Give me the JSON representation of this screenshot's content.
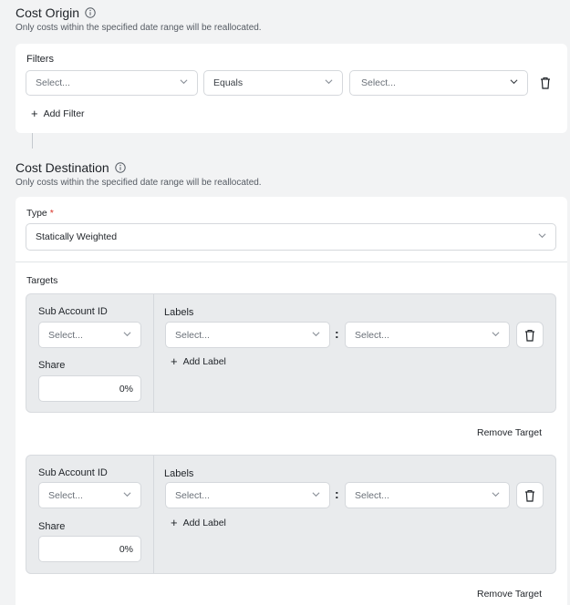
{
  "cost_origin": {
    "title": "Cost Origin",
    "subtitle": "Only costs within the specified date range will be reallocated.",
    "filters_label": "Filters",
    "filter_row": {
      "field_placeholder": "Select...",
      "operator_value": "Equals",
      "value_placeholder": "Select..."
    },
    "add_filter_label": "Add Filter"
  },
  "cost_destination": {
    "title": "Cost Destination",
    "subtitle": "Only costs within the specified date range will be reallocated.",
    "type_label": "Type",
    "type_required_mark": "*",
    "type_value": "Statically Weighted",
    "targets_label": "Targets",
    "targets": [
      {
        "sub_account_label": "Sub Account ID",
        "sub_account_placeholder": "Select...",
        "share_label": "Share",
        "share_value": "0%",
        "labels_label": "Labels",
        "label_key_placeholder": "Select...",
        "label_value_placeholder": "Select...",
        "add_label": "Add Label",
        "remove_label": "Remove Target"
      },
      {
        "sub_account_label": "Sub Account ID",
        "sub_account_placeholder": "Select...",
        "share_label": "Share",
        "share_value": "0%",
        "labels_label": "Labels",
        "label_key_placeholder": "Select...",
        "label_value_placeholder": "Select...",
        "add_label": "Add Label",
        "remove_label": "Remove Target"
      }
    ]
  },
  "icons": {
    "info": "info-icon",
    "chevron": "chevron-down-icon",
    "trash": "trash-icon",
    "plus": "plus-icon"
  },
  "colors": {
    "page_background": "#f2f3f4",
    "card_background": "#ffffff",
    "target_background": "#e9ebed",
    "required": "#d93025"
  }
}
